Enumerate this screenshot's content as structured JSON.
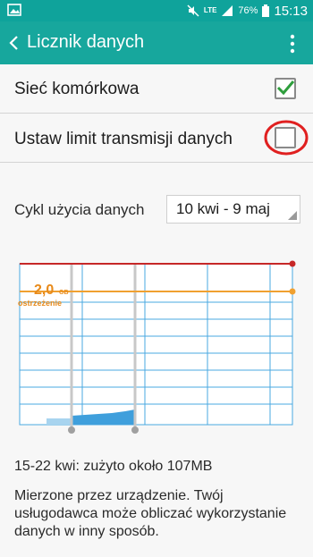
{
  "status_bar": {
    "network": "LTE",
    "battery": "76%",
    "time": "15:13"
  },
  "header": {
    "title": "Licznik danych"
  },
  "settings": {
    "mobile_data_label": "Sieć komórkowa",
    "mobile_data_checked": true,
    "set_limit_label": "Ustaw limit transmisji danych",
    "set_limit_checked": false
  },
  "cycle": {
    "label": "Cykl użycia danych",
    "value": "10 kwi - 9 maj"
  },
  "chart_data": {
    "type": "area",
    "warning": {
      "value": "2,0",
      "unit": "GB",
      "label": "ostrzeżenie",
      "color": "#f0a030"
    },
    "limit_color": "#c62828",
    "usage_color": "#4aa8e0",
    "usage_points": [
      0.02,
      0.025,
      0.03,
      0.035,
      0.04,
      0.05,
      0.06
    ],
    "selection_range": [
      "15 kwi",
      "22 kwi"
    ]
  },
  "usage": {
    "summary": "15-22 kwi: zużyto około 107MB",
    "note": "Mierzone przez urządzenie. Twój usługodawca może obliczać wykorzystanie danych w inny sposób."
  },
  "colors": {
    "accent": "#17a79d",
    "check": "#2e9e3c",
    "annotation": "#e02020"
  }
}
